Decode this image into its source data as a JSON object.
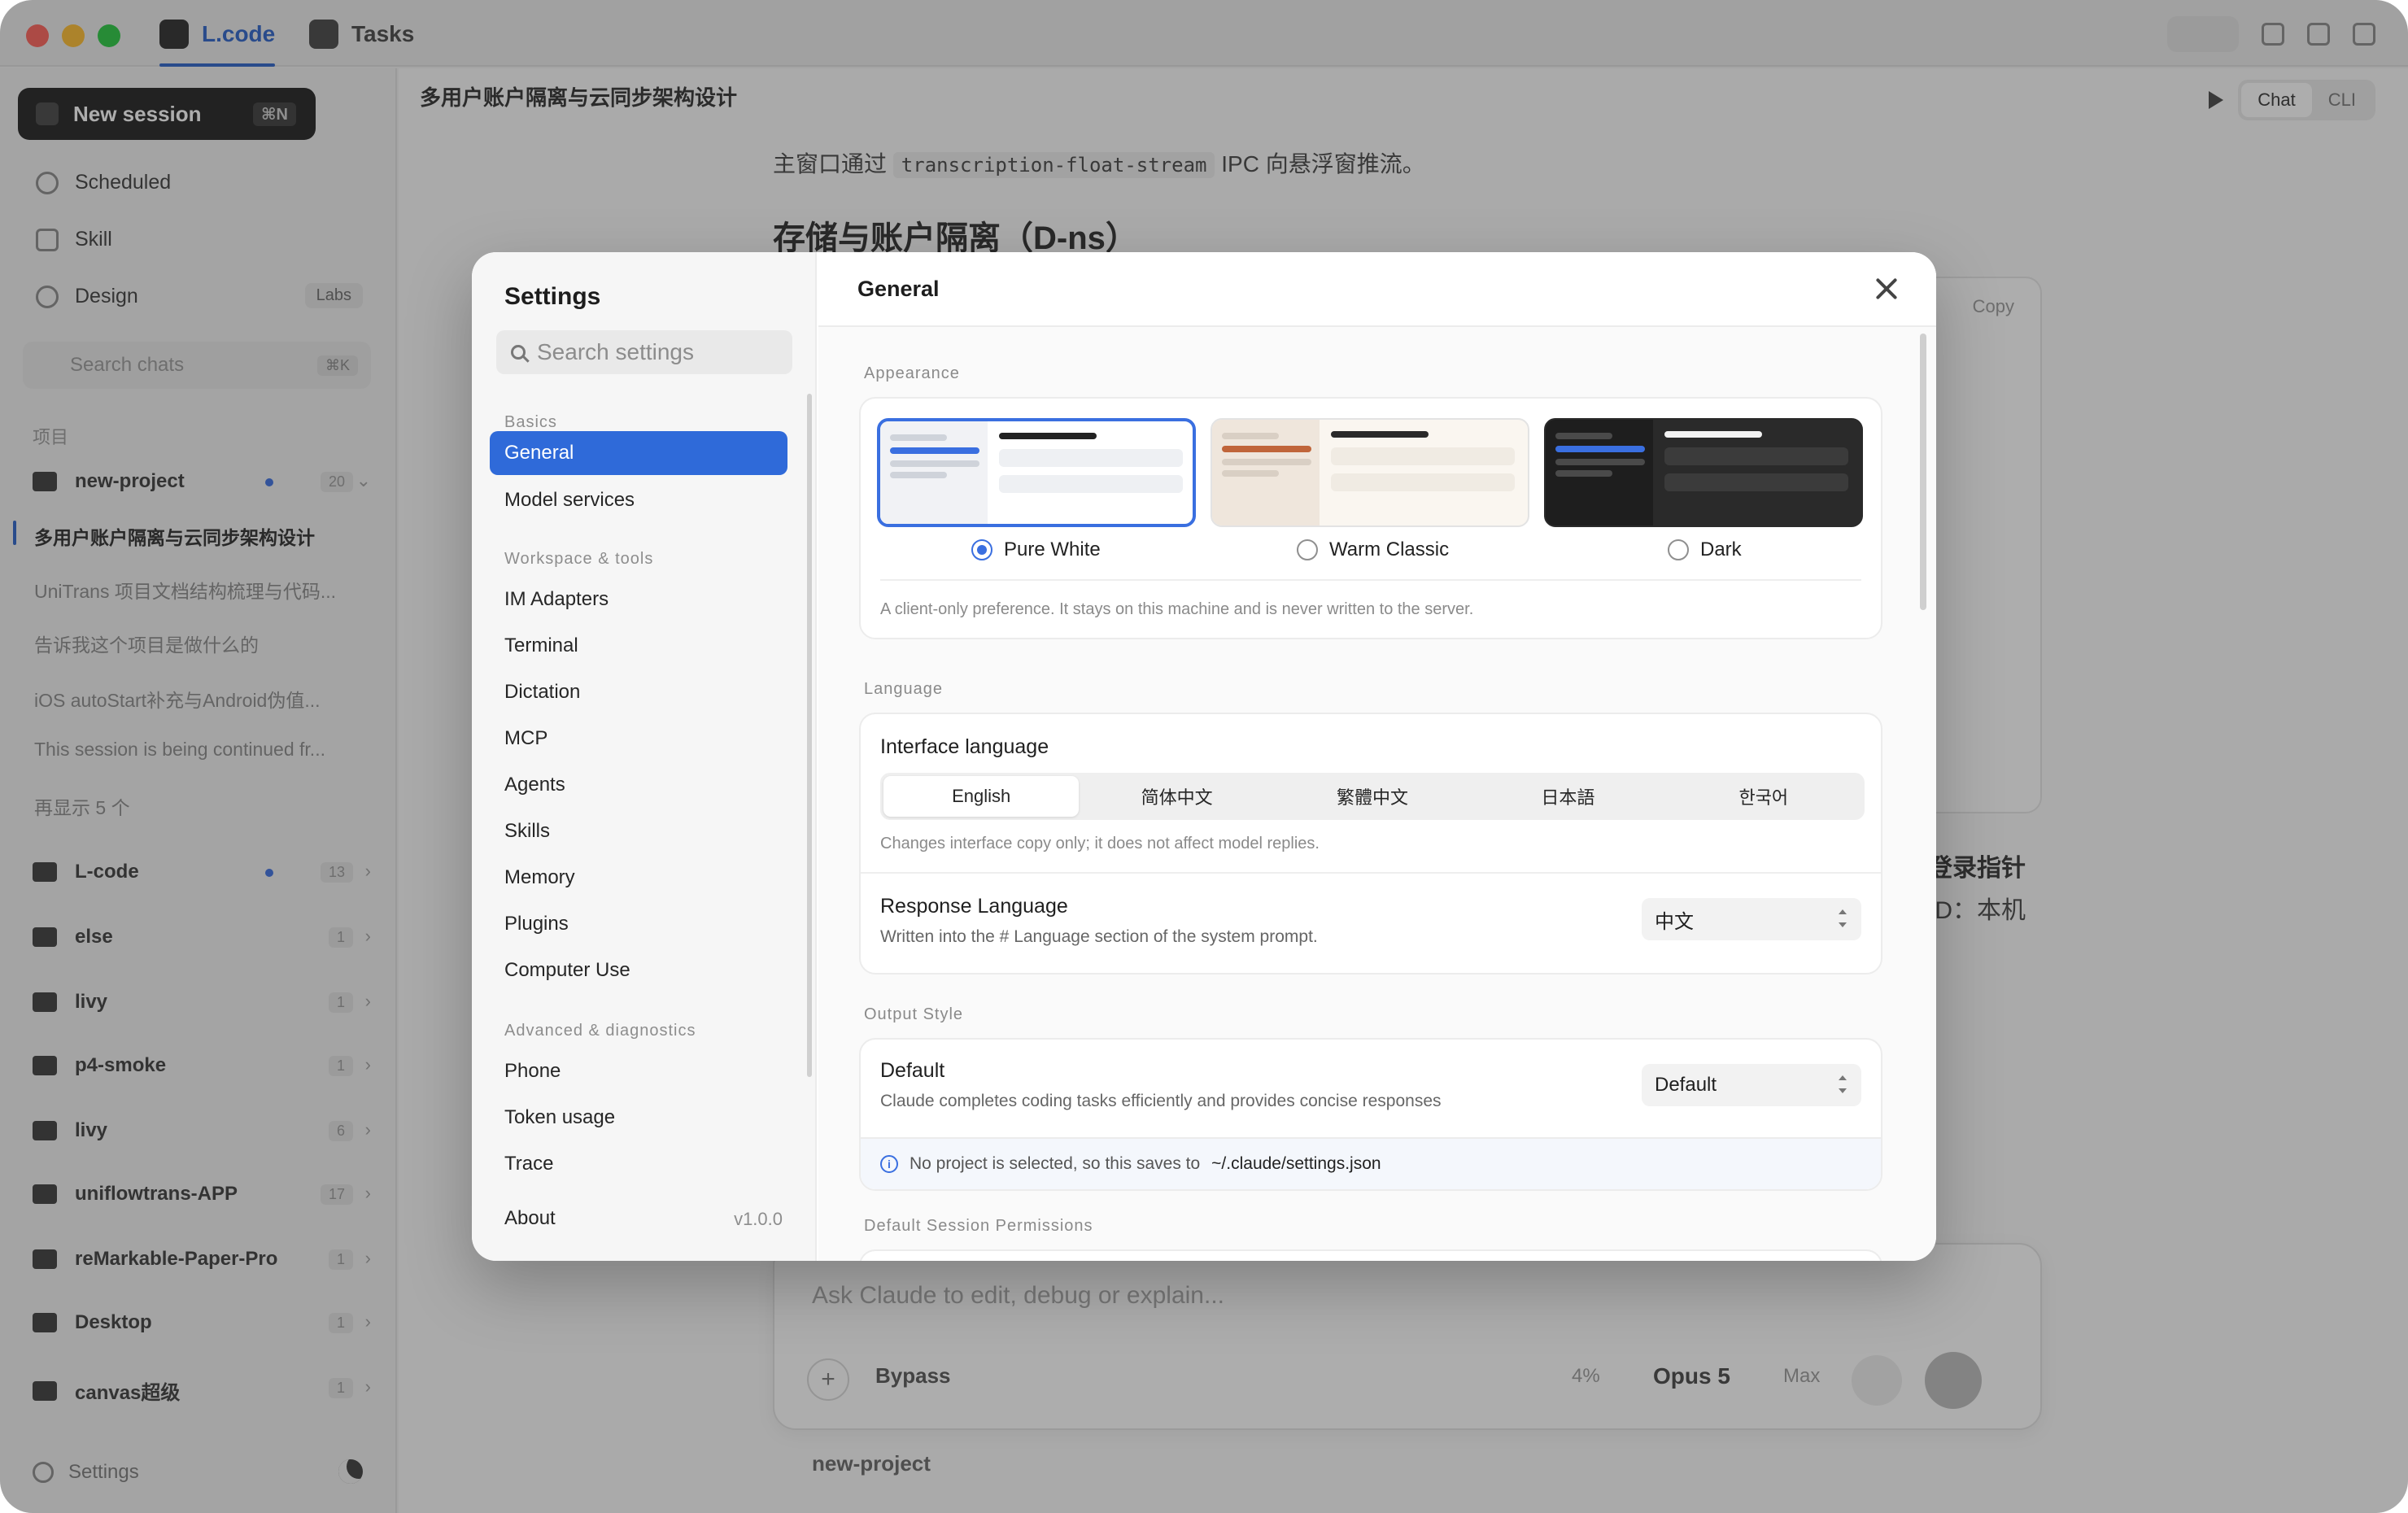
{
  "app": {
    "tabs": [
      {
        "label": "L.code",
        "active": true
      },
      {
        "label": "Tasks",
        "active": false
      }
    ]
  },
  "sidebar": {
    "new_session": "New session",
    "new_session_shortcut": "⌘N",
    "nav": [
      {
        "label": "Scheduled",
        "icon": "clock-icon"
      },
      {
        "label": "Skill",
        "icon": "toolbox-icon"
      },
      {
        "label": "Design",
        "icon": "palette-icon",
        "badge": "Labs"
      }
    ],
    "search_placeholder": "Search chats",
    "search_shortcut": "⌘K",
    "group_label": "项目",
    "projects": [
      {
        "name": "new-project",
        "count": "20"
      },
      {
        "name": "L-code",
        "count": "13"
      },
      {
        "name": "else",
        "count": "1"
      },
      {
        "name": "livy",
        "count": "1"
      },
      {
        "name": "p4-smoke",
        "count": "1"
      },
      {
        "name": "livy",
        "count": "6"
      },
      {
        "name": "uniflowtrans-APP",
        "count": "17"
      },
      {
        "name": "reMarkable-Paper-Pro",
        "count": "1"
      },
      {
        "name": "Desktop",
        "count": "1"
      },
      {
        "name": "canvas超级",
        "count": "1"
      }
    ],
    "chats": [
      "多用户账户隔离与云同步架构设计",
      "UniTrans 项目文档结构梳理与代码...",
      "告诉我这个项目是做什么的",
      "iOS autoStart补充与Android伪值...",
      "This session is being continued fr...",
      "再显示 5 个"
    ],
    "footer_settings": "Settings"
  },
  "main": {
    "title": "多用户账户隔离与云同步架构设计",
    "mode_tabs": [
      "Chat",
      "CLI"
    ],
    "doc_line_prefix": "主窗口通过",
    "doc_line_code": "transcription-float-stream",
    "doc_line_suffix": "IPC 向悬浮窗推流。",
    "doc_heading": "存储与账户隔离（D-ns）",
    "copy_label": "Copy",
    "side_text_1": "登录指针",
    "side_text_2": "ID：本机",
    "composer_placeholder": "Ask Claude to edit, debug or explain...",
    "permission_mode": "Bypass",
    "context_pct": "4%",
    "model": "Opus 5",
    "effort": "Max",
    "project_footer": "new-project"
  },
  "settings": {
    "title": "Settings",
    "search_placeholder": "Search settings",
    "sections": [
      {
        "label": "Basics",
        "items": [
          "General",
          "Model services"
        ]
      },
      {
        "label": "Workspace & tools",
        "items": [
          "IM Adapters",
          "Terminal",
          "Dictation",
          "MCP",
          "Agents",
          "Skills",
          "Memory",
          "Plugins",
          "Computer Use"
        ]
      },
      {
        "label": "Advanced & diagnostics",
        "items": [
          "Phone",
          "Token usage",
          "Trace"
        ]
      }
    ],
    "active_item": "General",
    "about": "About",
    "version": "v1.0.0",
    "panel_title": "General",
    "appearance": {
      "label": "Appearance",
      "themes": [
        {
          "name": "Pure White",
          "selected": true
        },
        {
          "name": "Warm Classic",
          "selected": false
        },
        {
          "name": "Dark",
          "selected": false
        }
      ],
      "hint": "A client-only preference. It stays on this machine and is never written to the server."
    },
    "language": {
      "label": "Language",
      "interface_title": "Interface language",
      "options": [
        "English",
        "简体中文",
        "繁體中文",
        "日本語",
        "한국어"
      ],
      "selected": "English",
      "interface_hint": "Changes interface copy only; it does not affect model replies.",
      "response_title": "Response Language",
      "response_sub": "Written into the # Language section of the system prompt.",
      "response_value": "中文"
    },
    "output_style": {
      "label": "Output Style",
      "title": "Default",
      "sub": "Claude completes coding tasks efficiently and provides concise responses",
      "value": "Default",
      "info_prefix": "No project is selected, so this saves to",
      "info_path": "~/.claude/settings.json"
    },
    "permissions_label": "Default Session Permissions"
  },
  "colors": {
    "accent": "#2f6ad9",
    "radio": "#3a6fe0",
    "traffic_red": "#fe5f57",
    "traffic_yellow": "#febc2e",
    "traffic_green": "#28c840"
  }
}
